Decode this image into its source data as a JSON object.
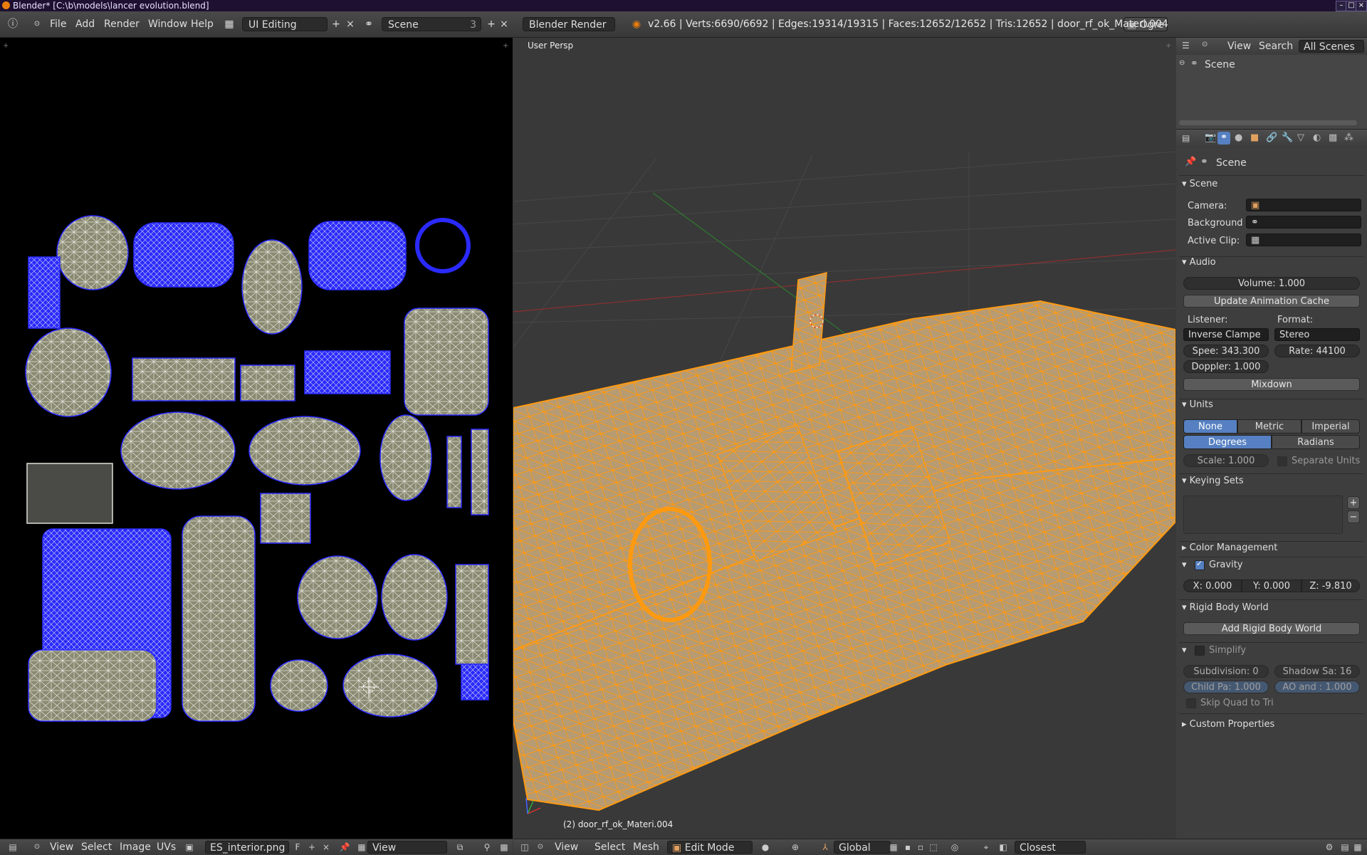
{
  "titlebar": {
    "title": "Blender* [C:\\b\\models\\lancer evolution.blend]"
  },
  "infobar": {
    "menus": [
      "File",
      "Add",
      "Render",
      "Window",
      "Help"
    ],
    "screen_layout": "UI Editing",
    "scene": "Scene",
    "scene_users": "3",
    "engine": "Blender Render",
    "stats": "v2.66 | Verts:6690/6692 | Edges:19314/19315 | Faces:12652/12652 | Tris:12652 | door_rf_ok_Materi.004",
    "ogre_label": "Ogre"
  },
  "view3d": {
    "viewport_label": "User Persp",
    "object_label": "(2) door_rf_ok_Materi.004"
  },
  "outliner": {
    "menus": [
      "View",
      "Search"
    ],
    "scope": "All Scenes",
    "tree_item": "Scene"
  },
  "properties": {
    "context": "Scene",
    "scene_panel": {
      "title": "Scene",
      "camera_label": "Camera:",
      "background_label": "Background",
      "active_clip_label": "Active Clip:"
    },
    "audio_panel": {
      "title": "Audio",
      "volume": "Volume: 1.000",
      "update_cache": "Update Animation Cache",
      "listener_label": "Listener:",
      "format_label": "Format:",
      "listener_value": "Inverse Clampe",
      "format_value": "Stereo",
      "speed": "Spee: 343.300",
      "rate": "Rate: 44100",
      "doppler": "Doppler: 1.000",
      "mixdown": "Mixdown"
    },
    "units_panel": {
      "title": "Units",
      "systems": [
        "None",
        "Metric",
        "Imperial"
      ],
      "active_system": "None",
      "rotation": [
        "Degrees",
        "Radians"
      ],
      "active_rotation": "Degrees",
      "scale": "Scale: 1.000",
      "separate_units": "Separate Units"
    },
    "keying_panel": {
      "title": "Keying Sets"
    },
    "color_mgmt": {
      "title": "Color Management"
    },
    "gravity_panel": {
      "title": "Gravity",
      "checked": true,
      "x": "X: 0.000",
      "y": "Y: 0.000",
      "z": "Z: -9.810"
    },
    "rigid_panel": {
      "title": "Rigid Body World",
      "add_button": "Add Rigid Body World"
    },
    "simplify_panel": {
      "title": "Simplify",
      "checked": false,
      "subdivision": "Subdivision: 0",
      "shadow_samples": "Shadow Sa: 16",
      "child_particles": "Child Pa: 1.000",
      "ao_and_sss": "AO and : 1.000",
      "skip_quad": "Skip Quad to Tri"
    },
    "custom_props": {
      "title": "Custom Properties"
    }
  },
  "uv_footer": {
    "menus": [
      "View",
      "Select",
      "Image",
      "UVs"
    ],
    "image_name": "ES_interior.png",
    "fake_user": "F",
    "mode": "View"
  },
  "view3d_footer": {
    "menus": [
      "View",
      "Select",
      "Mesh"
    ],
    "mode": "Edit Mode",
    "orientation": "Global",
    "snap_target": "Closest"
  },
  "colors": {
    "uv_edge": "#2a2aff",
    "mesh_edge": "#ff9a10",
    "mesh_face": "#b79b72",
    "toggle_active": "#5680c2"
  }
}
